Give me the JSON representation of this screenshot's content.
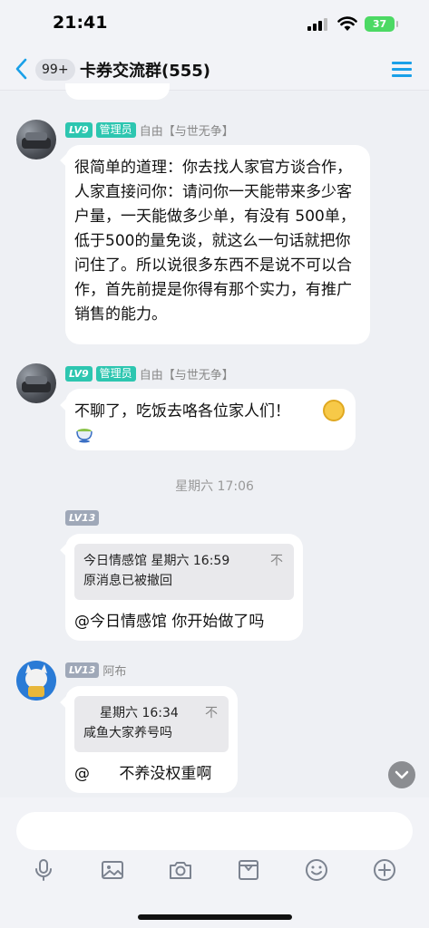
{
  "status_bar": {
    "time": "21:41",
    "battery": "37"
  },
  "header": {
    "unread_badge": "99+",
    "title": "卡券交流群(555)"
  },
  "messages": [
    {
      "level": "LV9",
      "role": "管理员",
      "sender": "自由【与世无争】",
      "text": "很简单的道理：你去找人家官方谈合作，人家直接问你：请问你一天能带来多少客户量，一天能做多少单，有没有 500单，低于500的量免谈，就这么一句话就把你问住了。所以说很多东西不是说不可以合作，首先前提是你得有那个实力，有推广销售的能力。"
    },
    {
      "level": "LV9",
      "role": "管理员",
      "sender": "自由【与世无争】",
      "text": "不聊了，吃饭去咯各位家人们！"
    },
    {
      "level": "LV13",
      "quote_header": "今日情感馆  星期六 16:59",
      "quote_mark": "不",
      "quote_text": "原消息已被撤回",
      "text": "@今日情感馆 你开始做了吗"
    },
    {
      "level": "LV13",
      "sender": "阿布",
      "quote_header": "星期六 16:34",
      "quote_mark": "不",
      "quote_text": "咸鱼大家养号吗",
      "text": "@      不养没权重啊"
    }
  ],
  "timestamp": "星期六 17:06",
  "icons": [
    "chevron-left-icon",
    "menu-icon",
    "microphone-icon",
    "image-icon",
    "camera-icon",
    "gift-icon",
    "smile-icon",
    "plus-circle-icon",
    "chevron-down-icon"
  ]
}
